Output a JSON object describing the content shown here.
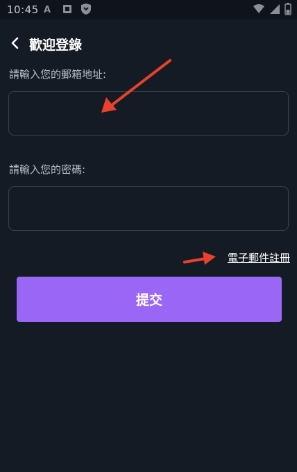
{
  "status_bar": {
    "time": "10:45",
    "icons_left": [
      "a-icon",
      "notification-icon",
      "shield-icon"
    ],
    "icons_right": [
      "wifi-icon",
      "signal-icon",
      "battery-icon"
    ]
  },
  "header": {
    "title": "歡迎登錄",
    "back_icon": "chevron-left-icon"
  },
  "email": {
    "label": "請輸入您的郵箱地址:",
    "value": "",
    "placeholder": ""
  },
  "password": {
    "label": "請輸入您的密碼:",
    "value": "",
    "placeholder": ""
  },
  "register_link": "電子郵件註冊",
  "submit_label": "提交",
  "colors": {
    "background": "#151b25",
    "accent": "#9a66f5",
    "annotation_arrow": "#e8412c"
  }
}
